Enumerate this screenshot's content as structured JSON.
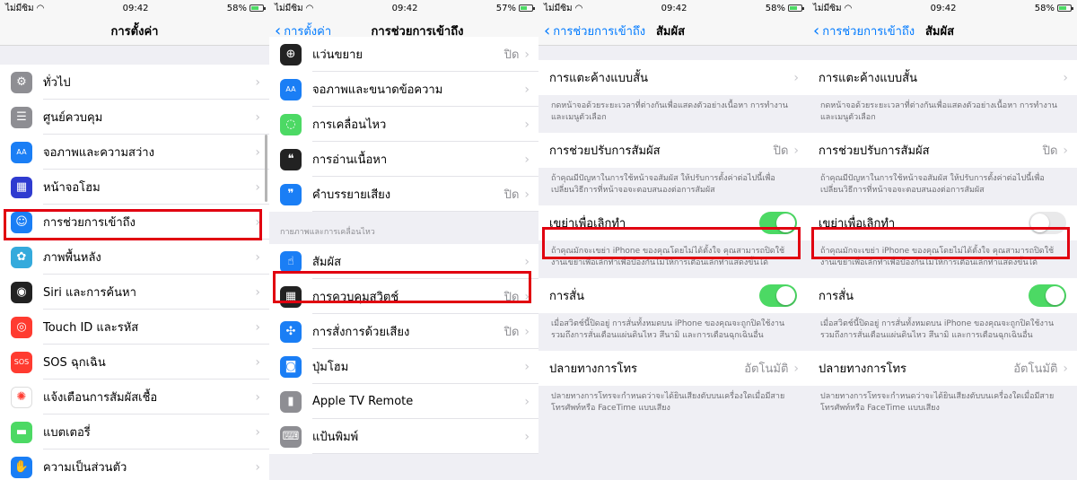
{
  "colors": {
    "accent": "#007aff",
    "switch_on": "#4cd964",
    "highlight": "#e10010"
  },
  "status": {
    "carrier": "ไม่มีซิม",
    "panels": [
      {
        "time": "09:42",
        "battery": "58%",
        "battery_level": 0.58
      },
      {
        "time": "09:42",
        "battery": "57%",
        "battery_level": 0.57
      },
      {
        "time": "09:42",
        "battery": "58%",
        "battery_level": 0.58
      },
      {
        "time": "09:42",
        "battery": "58%",
        "battery_level": 0.58
      }
    ]
  },
  "panel1": {
    "title": "การตั้งค่า",
    "items": [
      {
        "label": "ทั่วไป",
        "icon": "gear-icon",
        "color": "#8e8e93"
      },
      {
        "label": "ศูนย์ควบคุม",
        "icon": "toggles-icon",
        "color": "#8e8e93"
      },
      {
        "label": "จอภาพและความสว่าง",
        "icon": "display-aa-icon",
        "color": "#1a7ef5"
      },
      {
        "label": "หน้าจอโฮม",
        "icon": "home-grid-icon",
        "color": "#2f3bd0"
      },
      {
        "label": "การช่วยการเข้าถึง",
        "icon": "accessibility-icon",
        "color": "#1a7ef5"
      },
      {
        "label": "ภาพพื้นหลัง",
        "icon": "flower-icon",
        "color": "#34aadc"
      },
      {
        "label": "Siri และการค้นหา",
        "icon": "siri-icon",
        "color": "#222"
      },
      {
        "label": "Touch ID และรหัส",
        "icon": "fingerprint-icon",
        "color": "#ff3b30"
      },
      {
        "label": "SOS ฉุกเฉิน",
        "icon": "sos-icon",
        "color": "#ff3b30"
      },
      {
        "label": "แจ้งเตือนการสัมผัสเชื้อ",
        "icon": "exposure-icon",
        "color": "#fff"
      },
      {
        "label": "แบตเตอรี่",
        "icon": "battery-icon",
        "color": "#4cd964"
      },
      {
        "label": "ความเป็นส่วนตัว",
        "icon": "hand-icon",
        "color": "#1a7ef5"
      }
    ]
  },
  "panel2": {
    "back": "การตั้งค่า",
    "title": "การช่วยการเข้าถึง",
    "items_top": [
      {
        "label": "แว่นขยาย",
        "value": "ปิด",
        "icon": "magnifier-icon",
        "color": "#222"
      },
      {
        "label": "จอภาพและขนาดข้อความ",
        "value": "",
        "icon": "text-size-aa-icon",
        "color": "#1a7ef5"
      },
      {
        "label": "การเคลื่อนไหว",
        "value": "",
        "icon": "motion-icon",
        "color": "#4cd964"
      },
      {
        "label": "การอ่านเนื้อหา",
        "value": "",
        "icon": "speech-bubble-icon",
        "color": "#222"
      },
      {
        "label": "คำบรรยายเสียง",
        "value": "ปิด",
        "icon": "audio-description-icon",
        "color": "#1a7ef5"
      }
    ],
    "section_header": "กายภาพและการเคลื่อนไหว",
    "items_bottom": [
      {
        "label": "สัมผัส",
        "value": "",
        "icon": "touch-hand-icon",
        "color": "#1a7ef5"
      },
      {
        "label": "การควบคุมสวิตช์",
        "value": "ปิด",
        "icon": "switch-control-icon",
        "color": "#222"
      },
      {
        "label": "การสั่งการด้วยเสียง",
        "value": "ปิด",
        "icon": "voice-control-icon",
        "color": "#1a7ef5"
      },
      {
        "label": "ปุ่มโฮม",
        "value": "",
        "icon": "home-button-icon",
        "color": "#1a7ef5"
      },
      {
        "label": "Apple TV Remote",
        "value": "",
        "icon": "remote-icon",
        "color": "#8e8e93"
      },
      {
        "label": "แป้นพิมพ์",
        "value": "",
        "icon": "keyboard-icon",
        "color": "#8e8e93"
      }
    ]
  },
  "touch": {
    "back": "การช่วยการเข้าถึง",
    "title": "สัมผัส",
    "reach": {
      "label": "การแตะค้างแบบสั้น",
      "note": "กดหน้าจอด้วยระยะเวลาที่ต่างกันเพื่อแสดงตัวอย่างเนื้อหา การทำงาน และเมนูตัวเลือก"
    },
    "accom": {
      "label": "การช่วยปรับการสัมผัส",
      "value": "ปิด",
      "note": "ถ้าคุณมีปัญหาในการใช้หน้าจอสัมผัส ให้ปรับการตั้งค่าต่อไปนี้เพื่อเปลี่ยนวิธีการที่หน้าจอจะตอบสนองต่อการสัมผัส"
    },
    "shake": {
      "label": "เขย่าเพื่อเลิกทำ",
      "note": "ถ้าคุณมักจะเขย่า iPhone ของคุณโดยไม่ได้ตั้งใจ คุณสามารถปิดใช้งานเขย่าเพื่อเลิกทำเพื่อป้องกันไม่ให้การเตือนเลิกทำแสดงขึ้นได้"
    },
    "vib": {
      "label": "การสั่น",
      "note": "เมื่อสวิตช์นี้ปิดอยู่ การสั่นทั้งหมดบน iPhone ของคุณจะถูกปิดใช้งานรวมถึงการสั่นเตือนแผ่นดินไหว สึนามิ และการเตือนฉุกเฉินอื่น"
    },
    "route": {
      "label": "ปลายทางการโทร",
      "value": "อัตโนมัติ",
      "note": "ปลายทางการโทรจะกำหนดว่าจะได้ยินเสียงตับบนเครื่องใดเมื่อมีสายโทรศัพท์หรือ FaceTime แบบเสียง"
    }
  },
  "panel3_shake_on": true,
  "panel4_shake_on": false
}
